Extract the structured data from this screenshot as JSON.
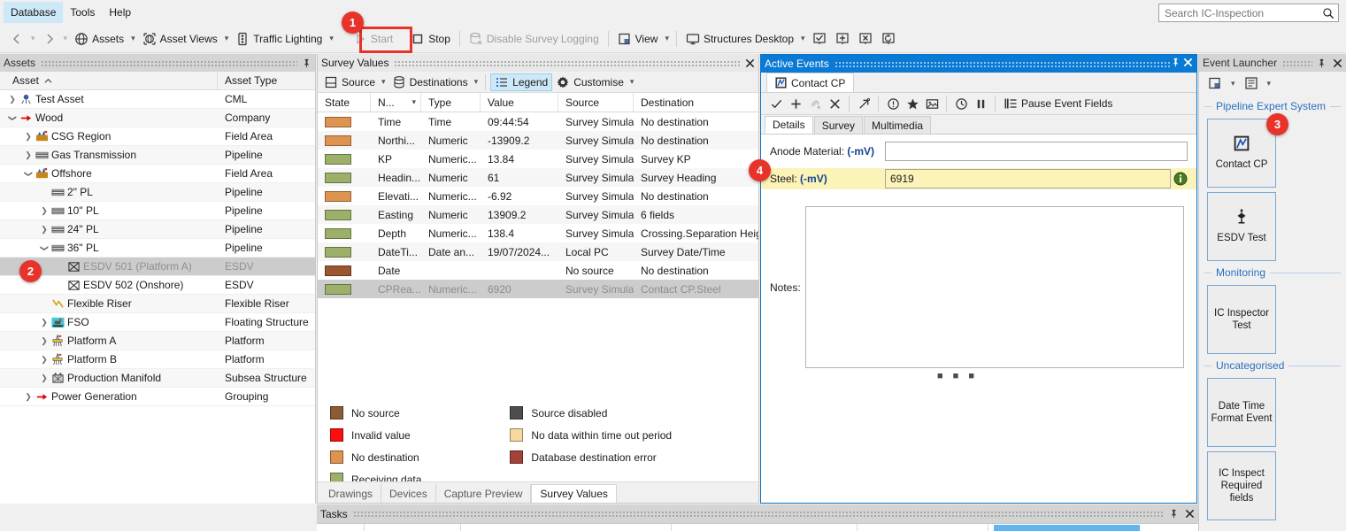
{
  "menu": {
    "items": [
      {
        "label": "Database",
        "active": true
      },
      {
        "label": "Tools",
        "active": false
      },
      {
        "label": "Help",
        "active": false
      }
    ]
  },
  "search": {
    "placeholder": "Search IC-Inspection",
    "value": "",
    "icon": "search-icon"
  },
  "toolbar": {
    "back_icon": "back-arrow-icon",
    "forward_icon": "forward-arrow-icon",
    "items": [
      {
        "label": "Assets",
        "icon": "globe-icon",
        "caret": true,
        "disabled": false
      },
      {
        "label": "Asset Views",
        "icon": "asset-views-icon",
        "caret": true,
        "disabled": false
      },
      {
        "label": "Traffic Lighting",
        "icon": "traffic-light-icon",
        "caret": true,
        "disabled": false
      },
      {
        "label": "Start",
        "icon": "play-icon",
        "caret": false,
        "disabled": true
      },
      {
        "label": "Stop",
        "icon": "stop-square-icon",
        "caret": false,
        "disabled": false
      },
      {
        "label": "Disable Survey Logging",
        "icon": "database-off-icon",
        "caret": false,
        "disabled": true
      },
      {
        "label": "View",
        "icon": "view-window-icon",
        "caret": true,
        "disabled": false
      },
      {
        "label": "Structures Desktop",
        "icon": "monitor-icon",
        "caret": true,
        "disabled": false
      }
    ],
    "desktop_icons": [
      "monitor-check-icon",
      "monitor-add-icon",
      "monitor-close-icon",
      "monitor-refresh-icon"
    ]
  },
  "annotations": [
    {
      "number": "1",
      "target": "start-button"
    },
    {
      "number": "2",
      "target": "esdv-501-tree-row"
    },
    {
      "number": "3",
      "target": "contact-cp-launcher-tile"
    },
    {
      "number": "4",
      "target": "steel-mv-field"
    }
  ],
  "assets": {
    "title": "Assets",
    "pin_icon": "pin-icon",
    "columns": [
      "Asset",
      "Asset Type"
    ],
    "sort_indicator": "chevron-up-icon",
    "rows": [
      {
        "label": "Test Asset",
        "type": "CML",
        "indent": 1,
        "twisty": "collapsed",
        "icon": "cml-icon",
        "selected": false,
        "dim": false
      },
      {
        "label": "Wood",
        "type": "Company",
        "indent": 1,
        "twisty": "expanded",
        "icon": "company-arrow-icon",
        "selected": false,
        "dim": false
      },
      {
        "label": "CSG Region",
        "type": "Field Area",
        "indent": 2,
        "twisty": "collapsed",
        "icon": "field-area-icon",
        "selected": false,
        "dim": false
      },
      {
        "label": "Gas Transmission",
        "type": "Pipeline",
        "indent": 2,
        "twisty": "collapsed",
        "icon": "pipeline-icon",
        "selected": false,
        "dim": false
      },
      {
        "label": "Offshore",
        "type": "Field Area",
        "indent": 2,
        "twisty": "expanded",
        "icon": "field-area-icon",
        "selected": false,
        "dim": false
      },
      {
        "label": "2\" PL",
        "type": "Pipeline",
        "indent": 3,
        "twisty": "none",
        "icon": "pipeline-icon",
        "selected": false,
        "dim": false
      },
      {
        "label": "10\" PL",
        "type": "Pipeline",
        "indent": 3,
        "twisty": "collapsed",
        "icon": "pipeline-icon",
        "selected": false,
        "dim": false
      },
      {
        "label": "24\" PL",
        "type": "Pipeline",
        "indent": 3,
        "twisty": "collapsed",
        "icon": "pipeline-icon",
        "selected": false,
        "dim": false
      },
      {
        "label": "36\" PL",
        "type": "Pipeline",
        "indent": 3,
        "twisty": "expanded",
        "icon": "pipeline-icon",
        "selected": false,
        "dim": false
      },
      {
        "label": "ESDV 501 (Platform A)",
        "type": "ESDV",
        "indent": 4,
        "twisty": "none",
        "icon": "esdv-icon",
        "selected": true,
        "dim": true
      },
      {
        "label": "ESDV 502 (Onshore)",
        "type": "ESDV",
        "indent": 4,
        "twisty": "none",
        "icon": "esdv-icon",
        "selected": false,
        "dim": false
      },
      {
        "label": "Flexible Riser",
        "type": "Flexible Riser",
        "indent": 3,
        "twisty": "none",
        "icon": "flexible-riser-icon",
        "selected": false,
        "dim": false
      },
      {
        "label": "FSO",
        "type": "Floating Structure",
        "indent": 3,
        "twisty": "collapsed",
        "icon": "fso-icon",
        "selected": false,
        "dim": false
      },
      {
        "label": "Platform A",
        "type": "Platform",
        "indent": 3,
        "twisty": "collapsed",
        "icon": "platform-icon",
        "selected": false,
        "dim": false
      },
      {
        "label": "Platform B",
        "type": "Platform",
        "indent": 3,
        "twisty": "collapsed",
        "icon": "platform-icon",
        "selected": false,
        "dim": false
      },
      {
        "label": "Production Manifold",
        "type": "Subsea Structure",
        "indent": 3,
        "twisty": "collapsed",
        "icon": "subsea-structure-icon",
        "selected": false,
        "dim": false
      },
      {
        "label": "Power Generation",
        "type": "Grouping",
        "indent": 2,
        "twisty": "collapsed",
        "icon": "grouping-arrow-icon",
        "selected": false,
        "dim": false
      }
    ]
  },
  "survey_values": {
    "title": "Survey Values",
    "close_icon": "close-icon",
    "toolbar": [
      {
        "label": "Source",
        "icon": "source-icon",
        "caret": true,
        "active": false
      },
      {
        "label": "Destinations",
        "icon": "destinations-icon",
        "caret": true,
        "active": false
      },
      {
        "label": "Legend",
        "icon": "legend-list-icon",
        "caret": false,
        "active": true
      },
      {
        "label": "Customise",
        "icon": "gear-icon",
        "caret": true,
        "active": false
      }
    ],
    "columns": [
      "State",
      "N...",
      "Type",
      "Value",
      "Source",
      "Destination"
    ],
    "sorted_column": "N...",
    "rows": [
      {
        "color": "#de9450",
        "name": "Time",
        "type": "Time",
        "value": "09:44:54",
        "source": "Survey Simulat...",
        "destination": "No destination",
        "selected": false
      },
      {
        "color": "#de9450",
        "name": "Northi...",
        "type": "Numeric",
        "value": "-13909.2",
        "source": "Survey Simulat...",
        "destination": "No destination",
        "selected": false
      },
      {
        "color": "#9cb069",
        "name": "KP",
        "type": "Numeric...",
        "value": "13.84",
        "source": "Survey Simulat...",
        "destination": "Survey KP",
        "selected": false
      },
      {
        "color": "#9cb069",
        "name": "Headin...",
        "type": "Numeric",
        "value": "61",
        "source": "Survey Simulat...",
        "destination": "Survey Heading",
        "selected": false
      },
      {
        "color": "#de9450",
        "name": "Elevati...",
        "type": "Numeric...",
        "value": "-6.92",
        "source": "Survey Simulat...",
        "destination": "No destination",
        "selected": false
      },
      {
        "color": "#9cb069",
        "name": "Easting",
        "type": "Numeric",
        "value": "13909.2",
        "source": "Survey Simulat...",
        "destination": "6 fields",
        "selected": false
      },
      {
        "color": "#9cb069",
        "name": "Depth",
        "type": "Numeric...",
        "value": "138.4",
        "source": "Survey Simulat...",
        "destination": "Crossing.Separation Height...",
        "selected": false
      },
      {
        "color": "#9cb069",
        "name": "DateTi...",
        "type": "Date an...",
        "value": "19/07/2024...",
        "source": "Local PC",
        "destination": "Survey Date/Time",
        "selected": false
      },
      {
        "color": "#9a5631",
        "name": "Date",
        "type": "",
        "value": "",
        "source": "No source",
        "destination": "No destination",
        "selected": false
      },
      {
        "color": "#9cb069",
        "name": "CPRea...",
        "type": "Numeric...",
        "value": "6920",
        "source": "Survey Simulat...",
        "destination": "Contact CP.Steel",
        "selected": true
      }
    ],
    "legend": {
      "left": [
        {
          "color": "#8c5a33",
          "label": "No source"
        },
        {
          "color": "#fd0d0d",
          "label": "Invalid value"
        },
        {
          "color": "#de9450",
          "label": "No destination"
        },
        {
          "color": "#9cb069",
          "label": "Receiving data"
        }
      ],
      "right": [
        {
          "color": "#4d4d4d",
          "label": "Source disabled"
        },
        {
          "color": "#f7d9a0",
          "label": "No data within time out period"
        },
        {
          "color": "#a3413a",
          "label": "Database destination error"
        }
      ]
    },
    "bottom_tabs": [
      {
        "label": "Drawings",
        "active": false
      },
      {
        "label": "Devices",
        "active": false
      },
      {
        "label": "Capture Preview",
        "active": false
      },
      {
        "label": "Survey Values",
        "active": true
      }
    ]
  },
  "active_events": {
    "title": "Active Events",
    "pin_icon": "pin-icon",
    "close_icon": "close-icon",
    "tabs": [
      {
        "label": "Contact CP",
        "icon": "contact-cp-icon",
        "active": true
      }
    ],
    "toolbar_icons": [
      "check-icon",
      "plus-icon",
      "link-add-icon",
      "close-x-icon",
      "launch-arrow-icon",
      "alert-circle-icon",
      "star-icon",
      "image-icon",
      "clock-icon",
      "pause-icon"
    ],
    "pause_button": {
      "label": "Pause Event Fields",
      "icon": "pause-fields-icon"
    },
    "sub_tabs": [
      {
        "label": "Details",
        "active": true
      },
      {
        "label": "Survey",
        "active": false
      },
      {
        "label": "Multimedia",
        "active": false
      }
    ],
    "fields": [
      {
        "label": "Anode Material:",
        "unit": "(-mV)",
        "value": "",
        "highlighted": false,
        "info": false
      },
      {
        "label": "Steel:",
        "unit": "(-mV)",
        "value": "6919",
        "highlighted": true,
        "info": true
      }
    ],
    "notes": {
      "label": "Notes:",
      "value": ""
    }
  },
  "event_launcher": {
    "title": "Event Launcher",
    "pin_icon": "pin-icon",
    "close_icon": "close-icon",
    "toolbar": [
      {
        "icon": "view-window-icon",
        "caret": true
      },
      {
        "icon": "list-icon",
        "caret": true
      }
    ],
    "groups": [
      {
        "name": "Pipeline Expert System",
        "tiles": [
          {
            "label": "Contact CP",
            "icon": "contact-cp-icon"
          },
          {
            "label": "ESDV Test",
            "icon": "esdv-test-icon"
          }
        ]
      },
      {
        "name": "Monitoring",
        "tiles": [
          {
            "label": "IC Inspector Test",
            "icon": ""
          }
        ]
      },
      {
        "name": "Uncategorised",
        "tiles": [
          {
            "label": "Date Time Format Event",
            "icon": ""
          },
          {
            "label": "IC Inspect Required fields",
            "icon": ""
          }
        ]
      }
    ]
  },
  "tasks": {
    "title": "Tasks",
    "pin_icon": "pin-icon",
    "close_icon": "close-icon"
  },
  "colors": {
    "accent_blue": "#0b7ad5",
    "annotation_red": "#e8332a",
    "highlight_yellow": "#fbf3b8",
    "selection_grey": "#cccccc"
  }
}
